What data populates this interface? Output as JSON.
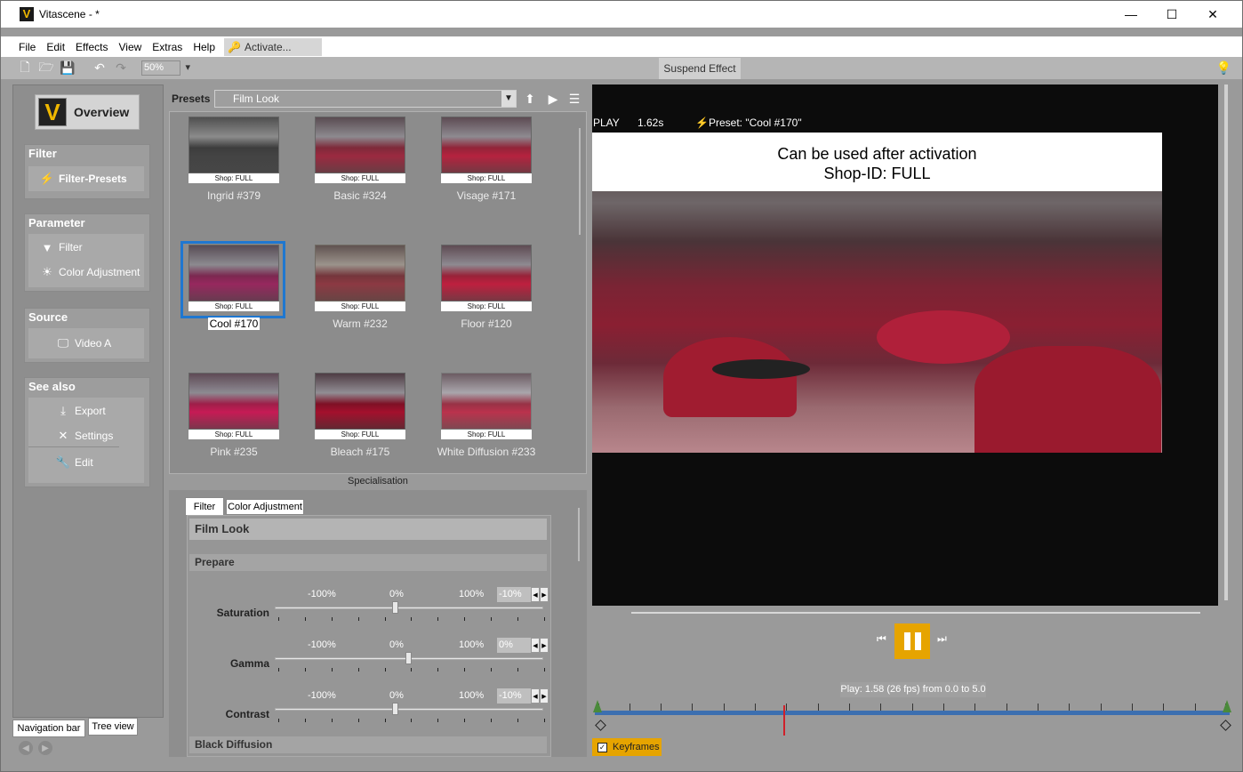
{
  "window": {
    "title": "Vitascene - *",
    "controls": [
      "—",
      "☐",
      "✕"
    ]
  },
  "menu": {
    "items": [
      "File",
      "Edit",
      "Effects",
      "View",
      "Extras",
      "Help"
    ],
    "activate": "Activate..."
  },
  "toolbar": {
    "zoom": "50%",
    "suspend": "Suspend Effect"
  },
  "nav": {
    "overview": "Overview",
    "groups": [
      {
        "title": "Filter",
        "items": [
          {
            "label": "Filter-Presets",
            "icon": "lightning-icon"
          }
        ]
      },
      {
        "title": "Parameter",
        "items": [
          {
            "label": "Filter",
            "icon": "funnel-icon"
          },
          {
            "label": "Color Adjustment",
            "icon": "sun-icon"
          }
        ]
      },
      {
        "title": "Source",
        "items": [
          {
            "label": "Video A",
            "icon": "monitor-icon"
          }
        ]
      },
      {
        "title": "See also",
        "items": [
          {
            "label": "Export",
            "icon": "download-icon"
          },
          {
            "label": "Settings",
            "icon": "wrench-screwdriver-icon"
          },
          {
            "label": "Edit",
            "icon": "wrench-icon"
          }
        ]
      }
    ],
    "tabs": [
      "Navigation bar",
      "Tree view"
    ]
  },
  "presets": {
    "label": "Presets",
    "selected": "Film Look",
    "shop_label": "Shop:  FULL",
    "items": [
      "Ingrid #379",
      "Basic #324",
      "Visage #171",
      "Cool #170",
      "Warm #232",
      "Floor #120",
      "Pink #235",
      "Bleach #175",
      "White Diffusion #233"
    ],
    "selected_index": 3
  },
  "specialisation": "Specialisation",
  "params": {
    "tabs": [
      "Filter",
      "Color Adjustment"
    ],
    "header": "Film Look",
    "section1": "Prepare",
    "section2": "Black Diffusion",
    "tick_labels": [
      "-100%",
      "0%",
      "100%"
    ],
    "sliders": [
      {
        "label": "Saturation",
        "value": "-10%",
        "position": 0.45
      },
      {
        "label": "Gamma",
        "value": "0%",
        "position": 0.5
      },
      {
        "label": "Contrast",
        "value": "-10%",
        "position": 0.45
      }
    ]
  },
  "viewer": {
    "state": "PLAY",
    "time": "1.62s",
    "preset": "Preset: \"Cool #170\"",
    "banner_line1": "Can be used after activation",
    "banner_line2": "Shop-ID:  FULL"
  },
  "playback": {
    "info": "Play: 1.58 (26 fps) from 0.0 to 5.0",
    "keyframes": "Keyframes",
    "keyframes_checked": "✓"
  }
}
